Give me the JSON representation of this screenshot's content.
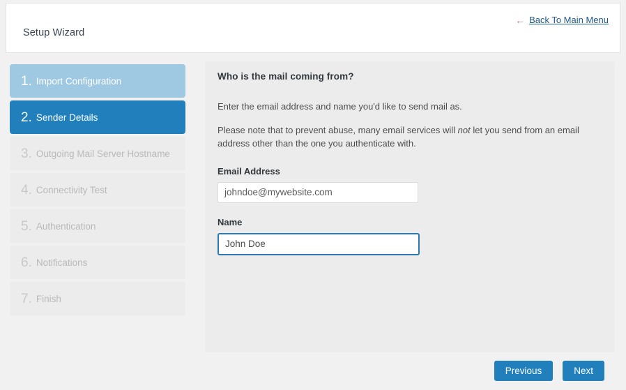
{
  "header": {
    "title": "Setup Wizard",
    "back_arrow_icon": "arrow-left-icon",
    "back_link": "Back To Main Menu"
  },
  "sidebar": {
    "steps": [
      {
        "num": "1.",
        "label": "Import Configuration",
        "state": "done"
      },
      {
        "num": "2.",
        "label": "Sender Details",
        "state": "active"
      },
      {
        "num": "3.",
        "label": "Outgoing Mail Server Hostname",
        "state": "pending"
      },
      {
        "num": "4.",
        "label": "Connectivity Test",
        "state": "pending"
      },
      {
        "num": "5.",
        "label": "Authentication",
        "state": "pending"
      },
      {
        "num": "6.",
        "label": "Notifications",
        "state": "pending"
      },
      {
        "num": "7.",
        "label": "Finish",
        "state": "pending"
      }
    ]
  },
  "main": {
    "heading": "Who is the mail coming from?",
    "paragraph1": "Enter the email address and name you'd like to send mail as.",
    "paragraph2_pre": "Please note that to prevent abuse, many email services will ",
    "paragraph2_em": "not",
    "paragraph2_post": " let you send from an email address other than the one you authenticate with.",
    "email_label": "Email Address",
    "email_value": "johndoe@mywebsite.com",
    "email_placeholder": "johndoe@mywebsite.com",
    "name_label": "Name",
    "name_value": "John Doe",
    "name_placeholder": "John Doe"
  },
  "footer": {
    "previous_label": "Previous",
    "next_label": "Next"
  },
  "colors": {
    "accent": "#2180bb",
    "step_done": "#9fc9e2",
    "page_bg": "#f1f1f1",
    "panel_bg": "#ececec",
    "link": "#1d5a8a",
    "arrow": "#b07f93"
  }
}
